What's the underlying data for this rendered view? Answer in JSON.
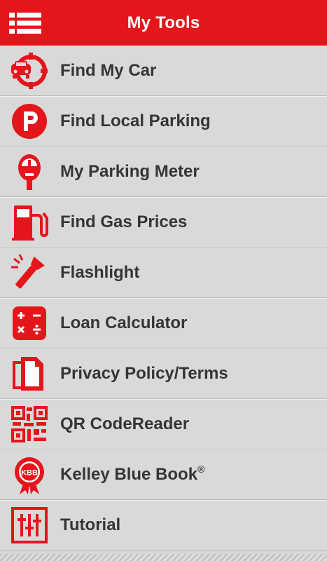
{
  "header": {
    "title": "My Tools"
  },
  "colors": {
    "accent": "#e4161b",
    "text": "#353535",
    "background": "#d8d8d8"
  },
  "items": [
    {
      "label": "Find My Car",
      "icon": "car-target-icon"
    },
    {
      "label": "Find Local Parking",
      "icon": "parking-icon"
    },
    {
      "label": "My Parking Meter",
      "icon": "parking-meter-icon"
    },
    {
      "label": "Find Gas Prices",
      "icon": "gas-pump-icon"
    },
    {
      "label": "Flashlight",
      "icon": "flashlight-icon"
    },
    {
      "label": "Loan Calculator",
      "icon": "calculator-icon"
    },
    {
      "label": "Privacy Policy/Terms",
      "icon": "document-icon"
    },
    {
      "label": "QR CodeReader",
      "icon": "qr-code-icon"
    },
    {
      "label": "Kelley Blue Book",
      "label_mark": "®",
      "icon": "kbb-badge-icon",
      "icon_text": "KBB"
    },
    {
      "label": "Tutorial",
      "icon": "sliders-icon"
    }
  ]
}
